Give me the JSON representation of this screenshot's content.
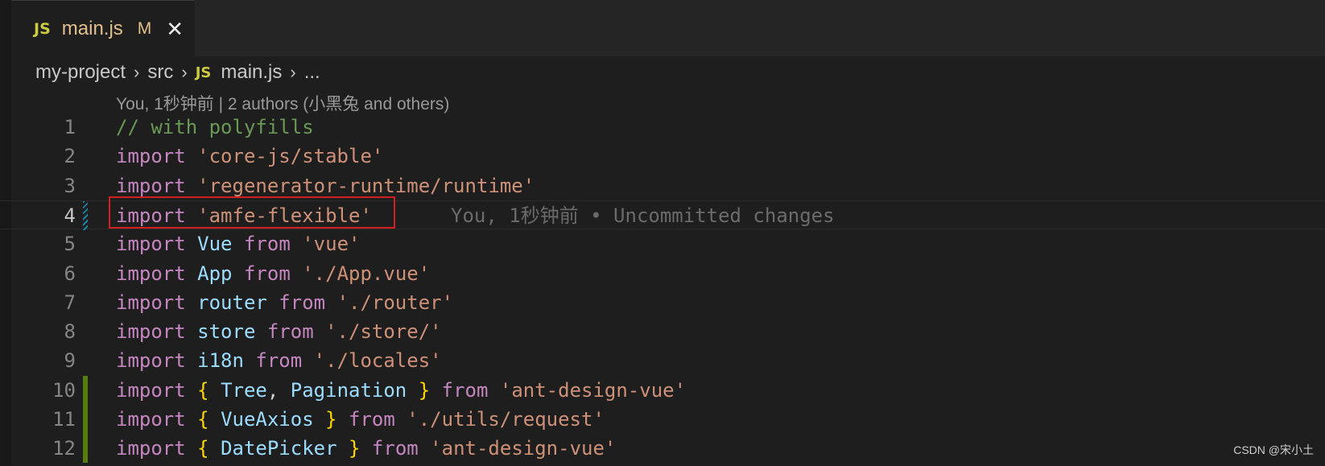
{
  "tab": {
    "badge": "JS",
    "title": "main.js",
    "status": "M",
    "close": "✕"
  },
  "breadcrumb": {
    "items": [
      "my-project",
      "src",
      "main.js",
      "..."
    ],
    "badge": "JS",
    "separator": "›"
  },
  "blame": {
    "header": "You, 1秒钟前 | 2 authors (小黑兔 and others)",
    "inline": "You, 1秒钟前 • Uncommitted changes"
  },
  "editor": {
    "line_numbers": [
      "1",
      "2",
      "3",
      "4",
      "5",
      "6",
      "7",
      "8",
      "9",
      "10",
      "11",
      "12"
    ],
    "lines": [
      [
        {
          "t": "// with polyfills",
          "c": "com"
        }
      ],
      [
        {
          "t": "import ",
          "c": "kw"
        },
        {
          "t": "'core-js/stable'",
          "c": "str"
        }
      ],
      [
        {
          "t": "import ",
          "c": "kw"
        },
        {
          "t": "'regenerator-runtime/runtime'",
          "c": "str"
        }
      ],
      [
        {
          "t": "import ",
          "c": "kw"
        },
        {
          "t": "'amfe-flexible'",
          "c": "str"
        }
      ],
      [
        {
          "t": "import ",
          "c": "kw"
        },
        {
          "t": "Vue",
          "c": "var"
        },
        {
          "t": " from ",
          "c": "kw"
        },
        {
          "t": "'vue'",
          "c": "str"
        }
      ],
      [
        {
          "t": "import ",
          "c": "kw"
        },
        {
          "t": "App",
          "c": "var"
        },
        {
          "t": " from ",
          "c": "kw"
        },
        {
          "t": "'./App.vue'",
          "c": "str"
        }
      ],
      [
        {
          "t": "import ",
          "c": "kw"
        },
        {
          "t": "router",
          "c": "var"
        },
        {
          "t": " from ",
          "c": "kw"
        },
        {
          "t": "'./router'",
          "c": "str"
        }
      ],
      [
        {
          "t": "import ",
          "c": "kw"
        },
        {
          "t": "store",
          "c": "var"
        },
        {
          "t": " from ",
          "c": "kw"
        },
        {
          "t": "'./store/'",
          "c": "str"
        }
      ],
      [
        {
          "t": "import ",
          "c": "kw"
        },
        {
          "t": "i18n",
          "c": "var"
        },
        {
          "t": " from ",
          "c": "kw"
        },
        {
          "t": "'./locales'",
          "c": "str"
        }
      ],
      [
        {
          "t": "import ",
          "c": "kw"
        },
        {
          "t": "{ ",
          "c": "brace"
        },
        {
          "t": "Tree",
          "c": "var"
        },
        {
          "t": ", ",
          "c": "plain"
        },
        {
          "t": "Pagination",
          "c": "var"
        },
        {
          "t": " }",
          "c": "brace"
        },
        {
          "t": " from ",
          "c": "kw"
        },
        {
          "t": "'ant-design-vue'",
          "c": "str"
        }
      ],
      [
        {
          "t": "import ",
          "c": "kw"
        },
        {
          "t": "{ ",
          "c": "brace"
        },
        {
          "t": "VueAxios",
          "c": "var"
        },
        {
          "t": " }",
          "c": "brace"
        },
        {
          "t": " from ",
          "c": "kw"
        },
        {
          "t": "'./utils/request'",
          "c": "str"
        }
      ],
      [
        {
          "t": "import ",
          "c": "kw"
        },
        {
          "t": "{ ",
          "c": "brace"
        },
        {
          "t": "DatePicker",
          "c": "var"
        },
        {
          "t": " }",
          "c": "brace"
        },
        {
          "t": " from ",
          "c": "kw"
        },
        {
          "t": "'ant-design-vue'",
          "c": "str"
        }
      ]
    ],
    "current_line": "4",
    "gutter_markers": {
      "4": "modified",
      "10": "added",
      "11": "added",
      "12": "added"
    }
  },
  "watermark": "CSDN @宋小土",
  "colors": {
    "background": "#1e1e1e",
    "keyword": "#c586c0",
    "string": "#ce9178",
    "identifier": "#9cdcfe",
    "comment": "#6a9955",
    "highlight_border": "#d41f1f"
  }
}
